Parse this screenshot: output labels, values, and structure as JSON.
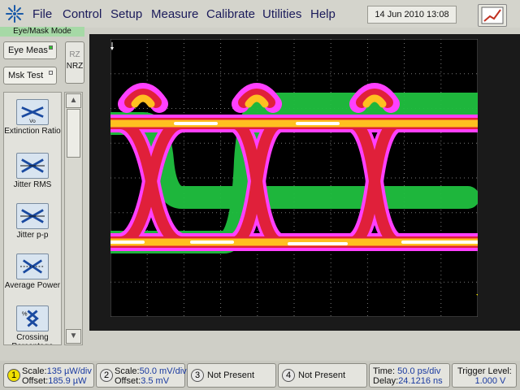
{
  "menu": {
    "items": [
      "File",
      "Control",
      "Setup",
      "Measure",
      "Calibrate",
      "Utilities",
      "Help"
    ],
    "datetime": "14 Jun 2010    13:08"
  },
  "left_panel": {
    "mode_label": "Eye/Mask Mode",
    "eye_meas_label": "Eye Meas",
    "mask_test_label": "Msk Test",
    "rz_label": "RZ",
    "nrz_label": "NRZ",
    "tools": [
      {
        "label": "Extinction Ratio",
        "icon": "extinction-ratio-icon"
      },
      {
        "label": "Jitter RMS",
        "icon": "jitter-rms-icon"
      },
      {
        "label": "Jitter p-p",
        "icon": "jitter-pp-icon"
      },
      {
        "label": "Average Power",
        "icon": "average-power-icon"
      },
      {
        "label": "Crossing Percentage",
        "icon": "crossing-percentage-icon"
      }
    ]
  },
  "status_bar": {
    "ch1": {
      "number": "1",
      "scale_label": "Scale:",
      "scale": "135 µW/div",
      "offset_label": "Offset:",
      "offset": "185.9 µW",
      "color": "#f0e000"
    },
    "ch2": {
      "number": "2",
      "scale_label": "Scale:",
      "scale": "50.0 mV/div",
      "offset_label": "Offset:",
      "offset": "3.5 mV"
    },
    "ch3": {
      "number": "3",
      "status": "Not Present"
    },
    "ch4": {
      "number": "4",
      "status": "Not Present"
    },
    "timebase": {
      "time_label": "Time:",
      "time": "50.0 ps/div",
      "delay_label": "Delay:",
      "delay": "24.1216 ns"
    },
    "trigger": {
      "label": "Trigger Level:",
      "value": "1.000 V"
    }
  },
  "colors": {
    "accent_green": "#a6d9a6",
    "trace_hot": "#ffffff",
    "trace_yellow": "#ffd000",
    "trace_red": "#e0203a",
    "trace_magenta": "#ff40ff",
    "trace_green": "#20c040"
  }
}
